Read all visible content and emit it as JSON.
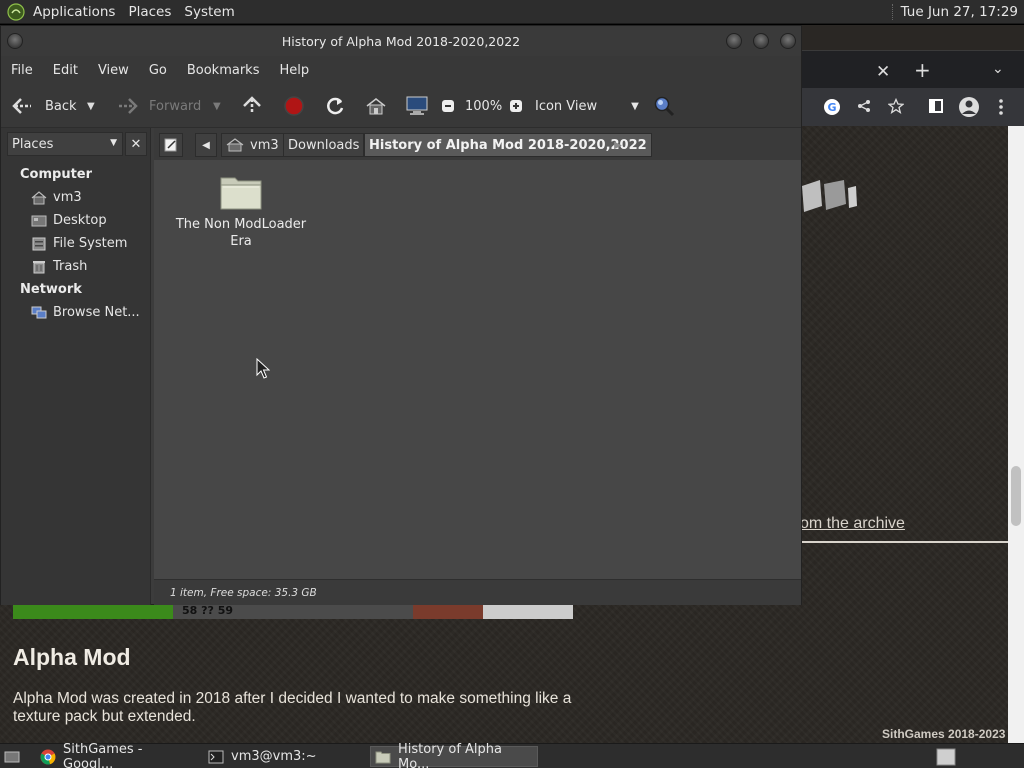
{
  "top_panel": {
    "menus": [
      "Applications",
      "Places",
      "System"
    ],
    "clock": "Tue Jun 27, 17:29"
  },
  "browser": {
    "link_text": "om the archive",
    "hotbar_text": "58 ?? 59",
    "heading": "Alpha Mod",
    "paragraph": "Alpha Mod was created in 2018 after I decided I wanted to make something like a texture pack but extended.",
    "footer": "SithGames 2018-2023"
  },
  "window": {
    "title": "History of Alpha Mod 2018-2020,2022"
  },
  "menubar": [
    "File",
    "Edit",
    "View",
    "Go",
    "Bookmarks",
    "Help"
  ],
  "toolbar": {
    "back_label": "Back",
    "forward_label": "Forward",
    "zoom_level": "100%",
    "view_mode": "Icon View"
  },
  "location": {
    "crumbs": [
      "vm3",
      "Downloads",
      "History of Alpha Mod 2018-2020,2022"
    ]
  },
  "sidebar": {
    "selector_label": "Places",
    "sections": {
      "computer": "Computer",
      "network": "Network"
    },
    "computer_items": [
      {
        "label": "vm3",
        "icon": "home-icon"
      },
      {
        "label": "Desktop",
        "icon": "desktop-icon"
      },
      {
        "label": "File System",
        "icon": "drive-icon"
      },
      {
        "label": "Trash",
        "icon": "trash-icon"
      }
    ],
    "network_items": [
      {
        "label": "Browse Net...",
        "icon": "network-icon"
      }
    ]
  },
  "content": {
    "items": [
      {
        "name": "The Non ModLoader Era",
        "icon": "folder-icon"
      }
    ]
  },
  "status": "1 item, Free space: 35.3 GB",
  "taskbar": {
    "tasks": [
      {
        "label": "SithGames - Googl...",
        "icon": "chrome-icon"
      },
      {
        "label": "vm3@vm3:~",
        "icon": "terminal-icon"
      },
      {
        "label": "History of Alpha Mo...",
        "icon": "folder-icon"
      }
    ]
  }
}
